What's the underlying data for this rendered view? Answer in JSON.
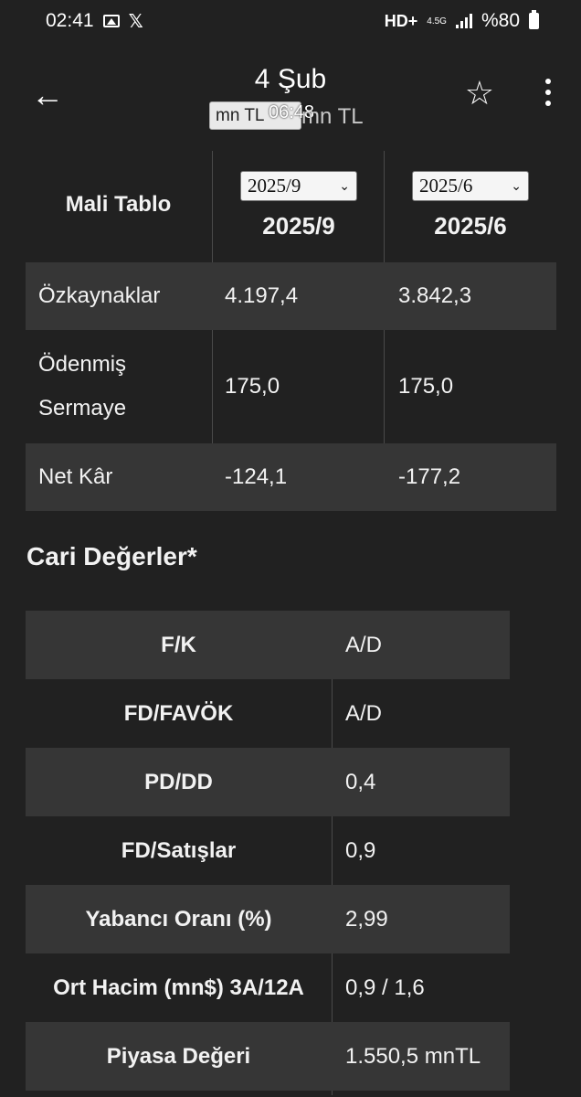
{
  "status_bar": {
    "time": "02:41",
    "network": "HD+",
    "network_type": "4.5G",
    "battery": "%80",
    "icons": [
      "image-icon",
      "x-logo-icon",
      "signal-icon",
      "battery-icon"
    ]
  },
  "header": {
    "title": "4 Şub",
    "unit_chip": "mn TL",
    "overlay_time": "06:48",
    "unit_text": "mn TL"
  },
  "fin_table": {
    "label": "Mali Tablo",
    "columns": [
      {
        "select_value": "2025/9",
        "label": "2025/9"
      },
      {
        "select_value": "2025/6",
        "label": "2025/6"
      }
    ],
    "rows": [
      {
        "name": "Özkaynaklar",
        "values": [
          "4.197,4",
          "3.842,3"
        ]
      },
      {
        "name_line1": "Ödenmiş",
        "name_line2": "Sermaye",
        "values": [
          "175,0",
          "175,0"
        ]
      },
      {
        "name": "Net Kâr",
        "values": [
          "-124,1",
          "-177,2"
        ]
      }
    ]
  },
  "current_values": {
    "title": "Cari Değerler*",
    "rows": [
      {
        "key": "F/K",
        "value": "A/D"
      },
      {
        "key": "FD/FAVÖK",
        "value": "A/D"
      },
      {
        "key": "PD/DD",
        "value": "0,4"
      },
      {
        "key": "FD/Satışlar",
        "value": "0,9"
      },
      {
        "key": "Yabancı Oranı (%)",
        "value": "2,99"
      },
      {
        "key": "Ort Hacim (mn$) 3A/12A",
        "value": "0,9 / 1,6"
      },
      {
        "key": "Piyasa Değeri",
        "value": "1.550,5 mnTL"
      }
    ]
  }
}
